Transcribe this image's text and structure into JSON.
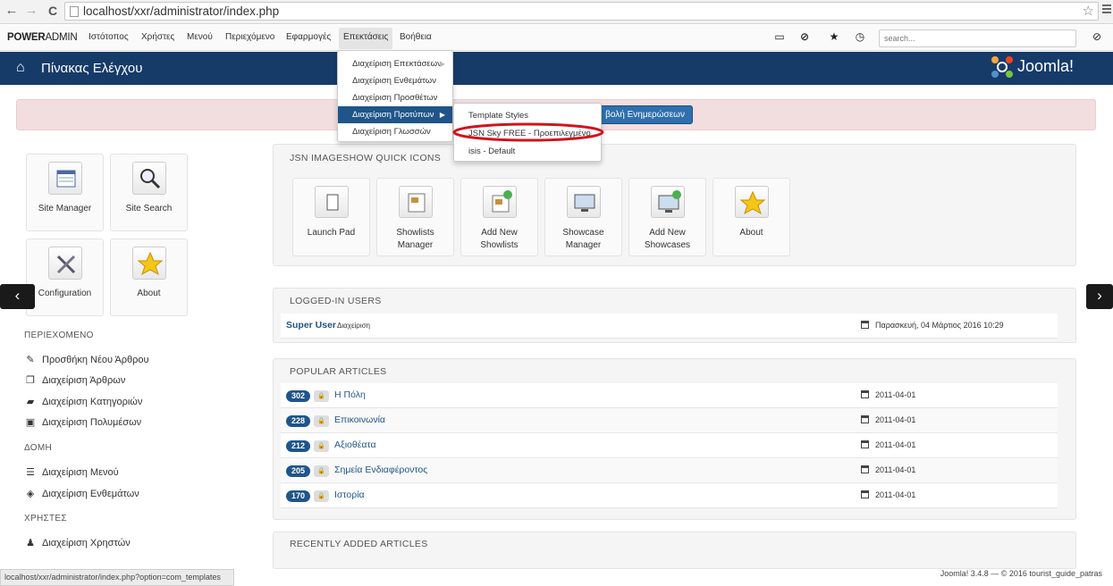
{
  "browser": {
    "url": "localhost/xxr/administrator/index.php",
    "back": "←",
    "forward": "→",
    "reload": "C",
    "star": "☆"
  },
  "navbar": {
    "brand_bold": "POWER",
    "brand_light": "ADMIN",
    "items": [
      "Ιστότοπος",
      "Χρήστες",
      "Μενού",
      "Περιεχόμενο",
      "Εφαρμογές",
      "Επεκτάσεις",
      "Βοήθεια"
    ],
    "search_placeholder": "search..."
  },
  "header": {
    "title": "Πίνακας Ελέγχου",
    "logo_text": "Joomla!"
  },
  "alert": {
    "button_label": "βολή Ενημερώσεων"
  },
  "quick_left": [
    {
      "label": "Site Manager"
    },
    {
      "label": "Site Search"
    },
    {
      "label": "Configuration"
    },
    {
      "label": "About"
    }
  ],
  "sidebar": {
    "content_head": "ΠΕΡΙΕΧΟΜΕΝΟ",
    "content_links": [
      "Προσθήκη Νέου Άρθρου",
      "Διαχείριση Άρθρων",
      "Διαχείριση Κατηγοριών",
      "Διαχείριση Πολυμέσων"
    ],
    "structure_head": "ΔΟΜΗ",
    "structure_links": [
      "Διαχείριση Μενού",
      "Διαχείριση Ενθεμάτων"
    ],
    "users_head": "ΧΡΗΣΤΕΣ",
    "users_links": [
      "Διαχείριση Χρηστών"
    ]
  },
  "imageshow": {
    "heading": "JSN IMAGESHOW QUICK ICONS",
    "icons": [
      {
        "line1": "Launch Pad",
        "line2": ""
      },
      {
        "line1": "Showlists",
        "line2": "Manager"
      },
      {
        "line1": "Add New",
        "line2": "Showlists"
      },
      {
        "line1": "Showcase",
        "line2": "Manager"
      },
      {
        "line1": "Add New",
        "line2": "Showcases"
      },
      {
        "line1": "About",
        "line2": ""
      }
    ]
  },
  "logged_in": {
    "heading": "LOGGED-IN USERS",
    "user": "Super User",
    "role": "Διαχείριση",
    "date": "Παρασκευή, 04 Μάρτιος 2016 10:29"
  },
  "popular": {
    "heading": "POPULAR ARTICLES",
    "rows": [
      {
        "hits": "302",
        "title": "Η Πόλη",
        "date": "2011-04-01"
      },
      {
        "hits": "228",
        "title": "Επικοινωνία",
        "date": "2011-04-01"
      },
      {
        "hits": "212",
        "title": "Αξιοθέατα",
        "date": "2011-04-01"
      },
      {
        "hits": "205",
        "title": "Σημεία Ενδιαφέροντος",
        "date": "2011-04-01"
      },
      {
        "hits": "170",
        "title": "Ιστορία",
        "date": "2011-04-01"
      }
    ]
  },
  "recent": {
    "heading": "RECENTLY ADDED ARTICLES"
  },
  "menu_extensions": [
    "Διαχείριση Επεκτάσεων",
    "Διαχείριση Ενθεμάτων",
    "Διαχείριση Προσθέτων",
    "Διαχείριση Προτύπων",
    "Διαχείριση Γλωσσών"
  ],
  "menu_templates": [
    "Template Styles",
    "JSN Sky FREE - Προεπιλεγμένο",
    "isis - Default"
  ],
  "status": {
    "link": "localhost/xxr/administrator/index.php?option=com_templates",
    "footer": "Joomla! 3.4.8 — © 2016 tourist_guide_patras"
  },
  "colors": {
    "header_bg": "#173b69",
    "highlight": "#1f5589",
    "annotation_circle": "#d0141c"
  }
}
